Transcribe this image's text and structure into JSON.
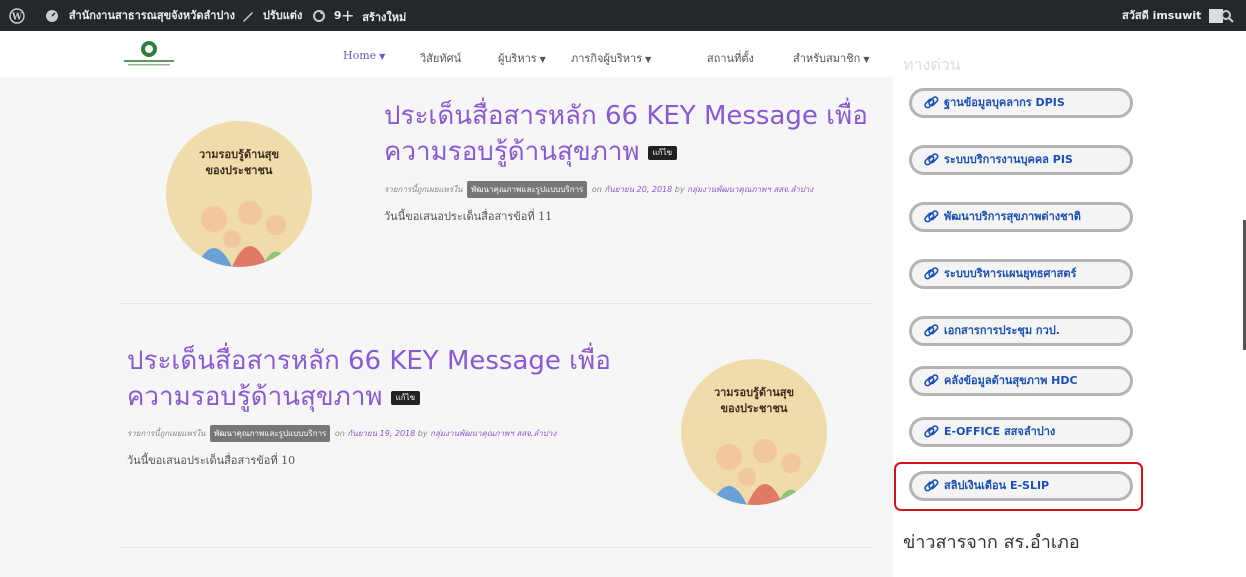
{
  "admin_bar": {
    "site_name": "สำนักงานสาธารณสุขจังหวัดลำปาง",
    "customize_label": "ปรับแต่ง",
    "updates_count": "9",
    "new_label": "สร้างใหม่",
    "greeting": "สวัสดี imsuwit"
  },
  "nav": {
    "items": [
      {
        "label": "Home",
        "has_caret": true
      },
      {
        "label": "วิสัยทัศน์",
        "has_caret": false
      },
      {
        "label": "ผู้บริหาร",
        "has_caret": true
      },
      {
        "label": "ภารกิจผู้บริหาร",
        "has_caret": true
      },
      {
        "label": "สถานที่ตั้ง",
        "has_caret": false
      },
      {
        "label": "สำหรับสมาชิก",
        "has_caret": true
      }
    ]
  },
  "posts": [
    {
      "title_line1": "ประเด็นสื่อสารหลัก 66 KEY Message เพื่อ",
      "title_line2": "ความรอบรู้ด้านสุขภาพ",
      "edit_label": "แก้ไข",
      "meta_prefix": "รายการนี้ถูกเผยแพร่ใน",
      "category": "พัฒนาคุณภาพและรูปแบบบริการ",
      "meta_on": "on",
      "date": "กันยายน 20, 2018",
      "meta_by": "by",
      "author": "กลุ่มงานพัฒนาคุณภาพฯ สสจ.ลำปาง",
      "excerpt": "วันนี้ขอเสนอประเด็นสื่อสารข้อที่ 11",
      "thumb_caption_1": "วามรอบรู้ด้านสุข",
      "thumb_caption_2": "ของประชาชน"
    },
    {
      "title_line1": "ประเด็นสื่อสารหลัก 66 KEY Message เพื่อ",
      "title_line2": "ความรอบรู้ด้านสุขภาพ",
      "edit_label": "แก้ไข",
      "meta_prefix": "รายการนี้ถูกเผยแพร่ใน",
      "category": "พัฒนาคุณภาพและรูปแบบบริการ",
      "meta_on": "on",
      "date": "กันยายน 19, 2018",
      "meta_by": "by",
      "author": "กลุ่มงานพัฒนาคุณภาพฯ สสจ.ลำปาง",
      "excerpt": "วันนี้ขอเสนอประเด็นสื่อสารข้อที่ 10",
      "thumb_caption_1": "วามรอบรู้ด้านสุข",
      "thumb_caption_2": "ของประชาชน"
    }
  ],
  "sidebar": {
    "heading": "ทางด่วน",
    "quick_links": [
      "ฐานข้อมูลบุคลากร DPIS",
      "ระบบบริการงานบุคคล PIS",
      "พัฒนาบริการสุขภาพต่างชาติ",
      "ระบบบริหารแผนยุทธศาสตร์",
      "เอกสารการประชุม กวป.",
      "คลังข้อมูลด้านสุขภาพ HDC",
      "E-OFFICE สสจลำปาง",
      "สลิปเงินเดือน E-SLIP"
    ],
    "news_heading": "ข่าวสารจาก สร.อำเภอ"
  },
  "colors": {
    "accent": "#8a5ad2",
    "admin_bar": "#23282d",
    "link_blue": "#1a4fb5",
    "highlight_red": "#d9121a"
  }
}
